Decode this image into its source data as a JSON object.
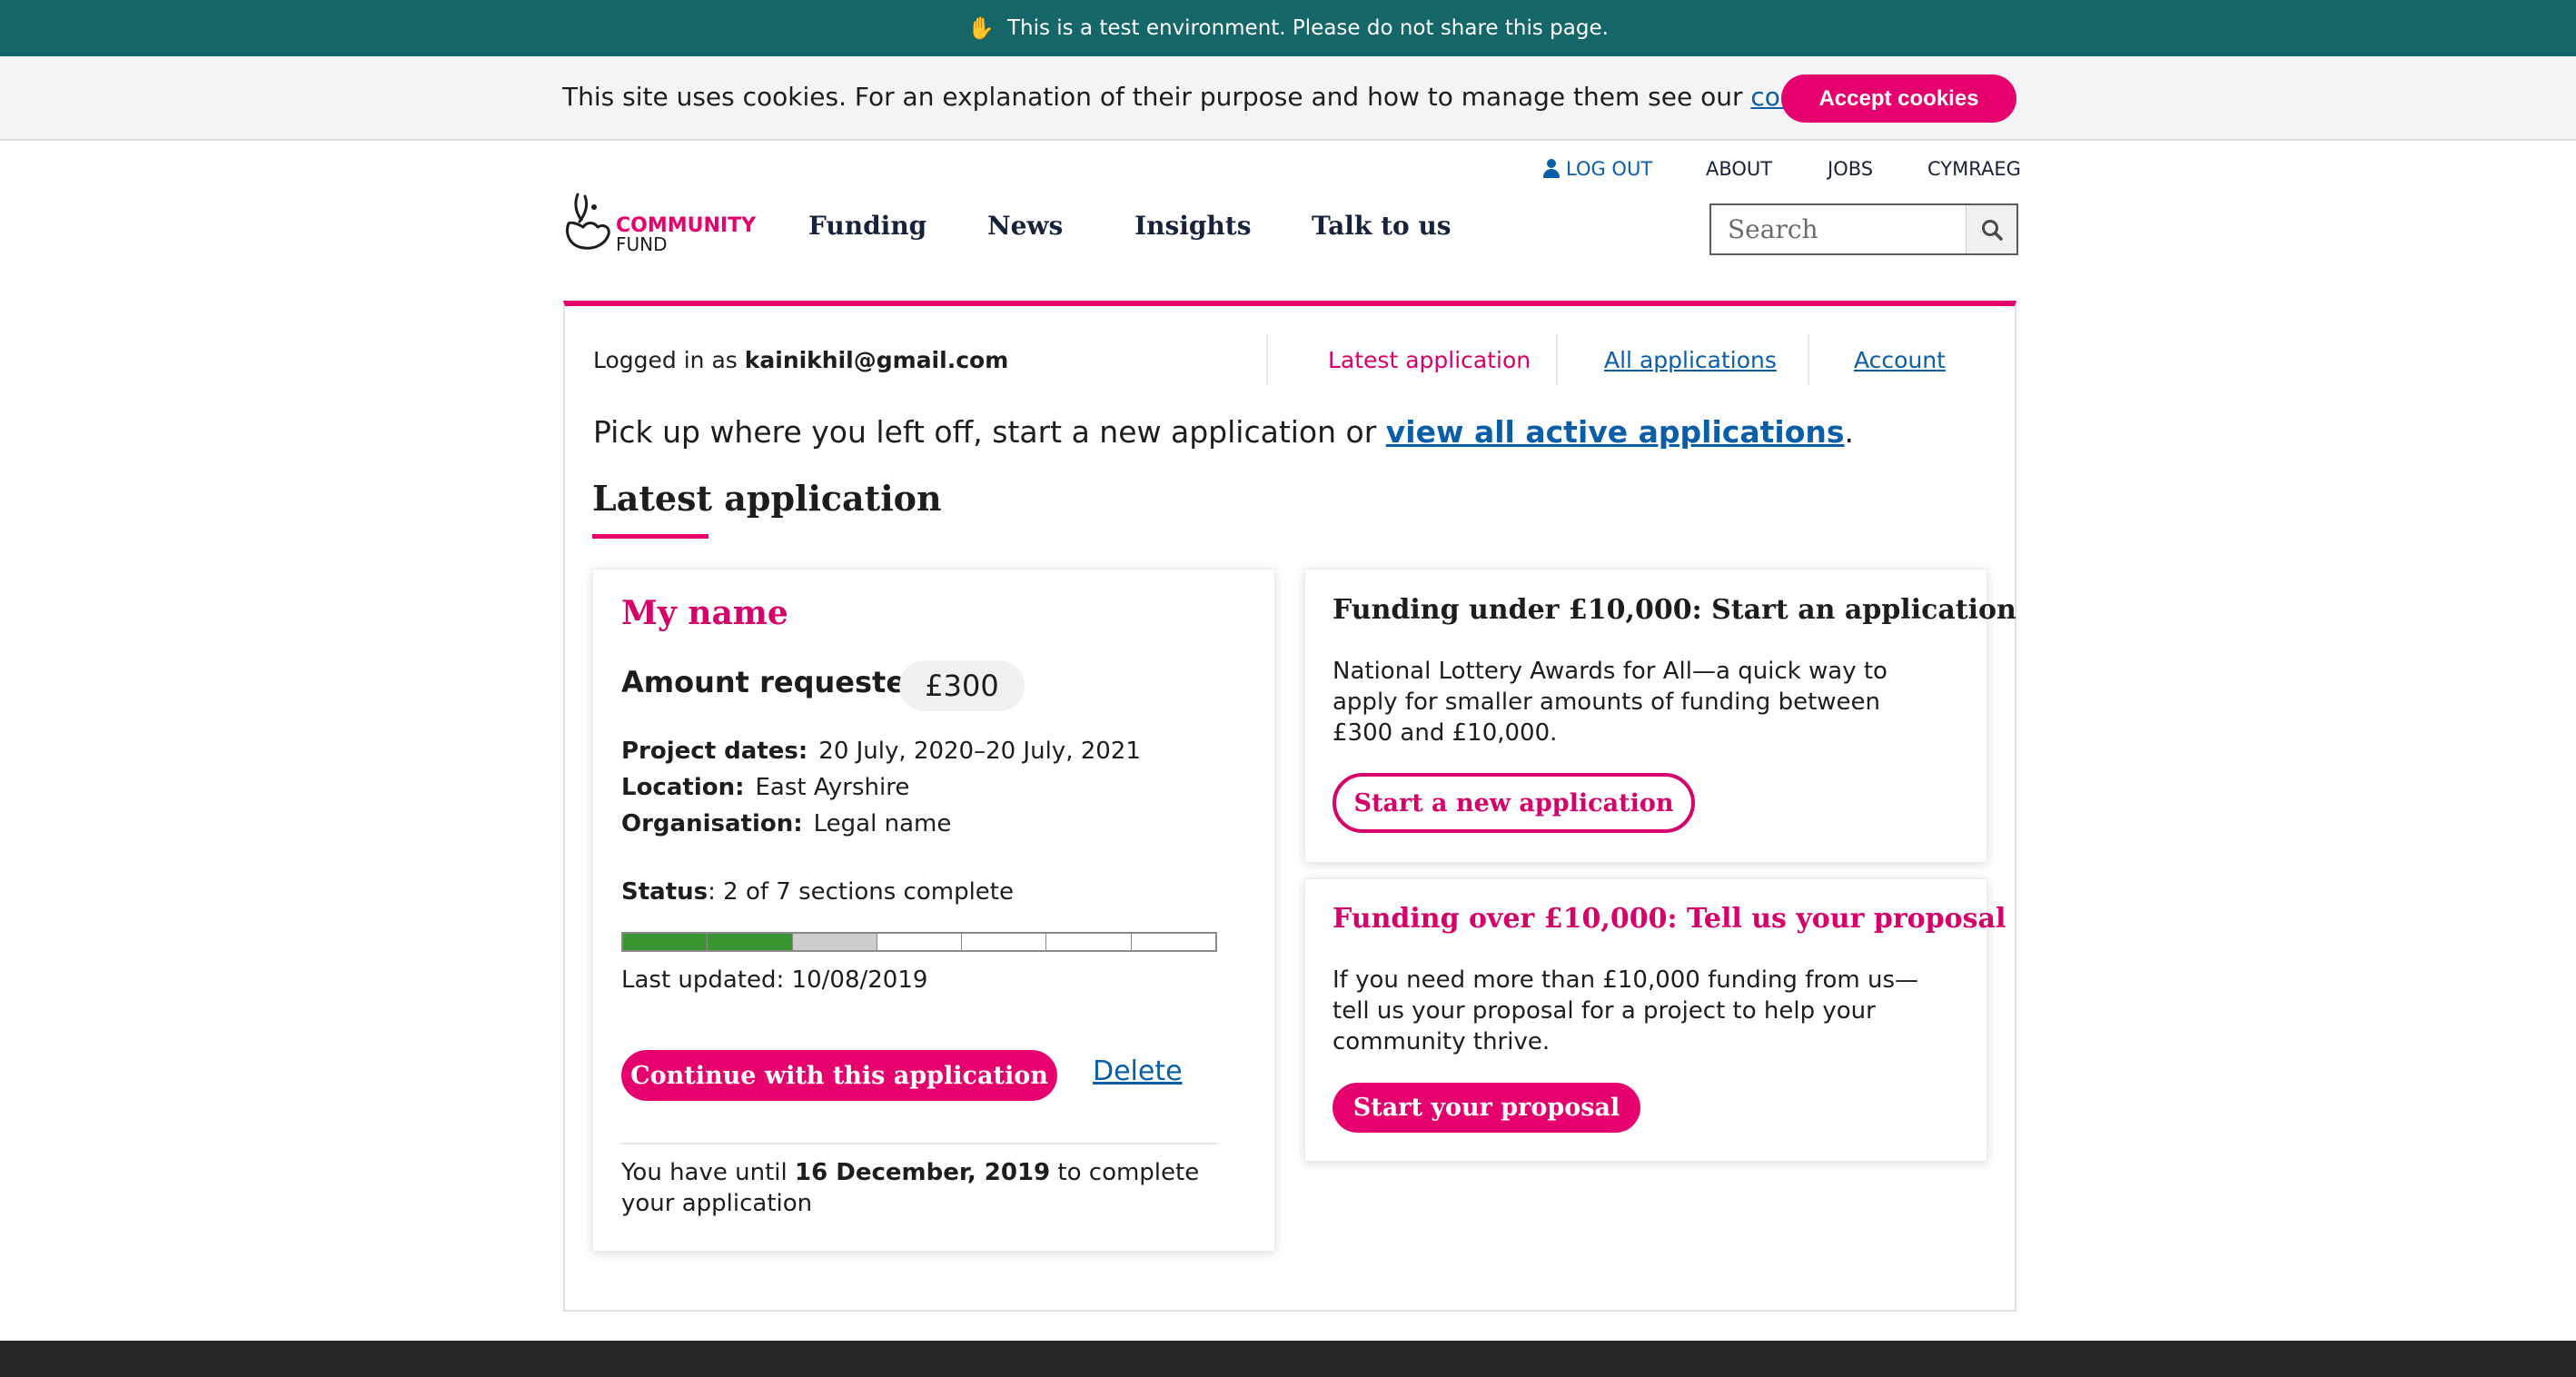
{
  "banner": {
    "icon": "hand-icon",
    "text": "This is a test environment. Please do not share this page."
  },
  "cookies": {
    "text_before": "This site uses cookies. For an explanation of their purpose and how to manage them see our ",
    "link": "cookies policy",
    "text_after": ".",
    "accept_label": "Accept cookies"
  },
  "utility_nav": {
    "logout": "LOG OUT",
    "about": "ABOUT",
    "jobs": "JOBS",
    "welsh": "CYMRAEG"
  },
  "logo": {
    "line1": "COMMUNITY",
    "line2": "FUND"
  },
  "main_nav": [
    "Funding",
    "News",
    "Insights",
    "Talk to us"
  ],
  "search": {
    "placeholder": "Search"
  },
  "dashboard": {
    "logged_in_prefix": "Logged in as ",
    "email": "kainikhil@gmail.com",
    "tabs": [
      "Latest application",
      "All applications",
      "Account"
    ],
    "intro_before": "Pick up where you left off, start a new application or ",
    "intro_link": "view all active applications",
    "intro_after": ".",
    "section_title": "Latest application"
  },
  "application": {
    "name": "My name",
    "amount_label": "Amount requested",
    "amount": "£300",
    "project_dates_label": "Project dates:",
    "project_dates": "20 July, 2020–20 July, 2021",
    "location_label": "Location:",
    "location": "East Ayrshire",
    "organisation_label": "Organisation:",
    "organisation": "Legal name",
    "status_label": "Status",
    "status": ": 2 of 7 sections complete",
    "progress": {
      "complete": 2,
      "total": 7
    },
    "last_updated": "Last updated: 10/08/2019",
    "continue_label": "Continue with this application",
    "delete_label": "Delete",
    "deadline_before": "You have until ",
    "deadline_date": "16 December, 2019",
    "deadline_after": " to complete your application"
  },
  "under_10k": {
    "title": "Funding under £10,000: Start an application",
    "body": "National Lottery Awards for All—a quick way to apply for smaller amounts of funding between £300 and £10,000.",
    "button": "Start a new application"
  },
  "over_10k": {
    "title": "Funding over £10,000: Tell us your proposal",
    "body": "If you need more than £10,000 funding from us—tell us your proposal for a project to help your community thrive.",
    "button": "Start your proposal"
  },
  "colors": {
    "brand": "#e6006e",
    "link": "#0a5ea8",
    "banner": "#146669",
    "progress_done": "#3b9631"
  }
}
